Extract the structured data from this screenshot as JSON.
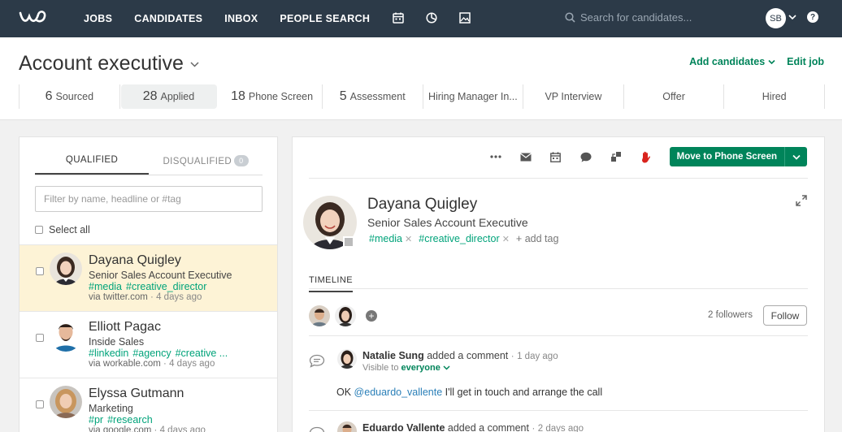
{
  "nav": {
    "items": [
      "JOBS",
      "CANDIDATES",
      "INBOX",
      "PEOPLE SEARCH"
    ],
    "icons": [
      "calendar-icon",
      "pie-chart-icon",
      "image-icon"
    ],
    "search_placeholder": "Search for candidates...",
    "user_initials": "SB",
    "help": "?"
  },
  "job": {
    "title": "Account executive",
    "add_candidates": "Add candidates",
    "edit_job": "Edit job",
    "stages": [
      {
        "count": "6",
        "label": "Sourced"
      },
      {
        "count": "28",
        "label": "Applied"
      },
      {
        "count": "18",
        "label": "Phone Screen"
      },
      {
        "count": "5",
        "label": "Assessment"
      },
      {
        "count": "",
        "label": "Hiring Manager In..."
      },
      {
        "count": "",
        "label": "VP Interview"
      },
      {
        "count": "",
        "label": "Offer"
      },
      {
        "count": "",
        "label": "Hired"
      }
    ]
  },
  "list": {
    "tab_qualified": "QUALIFIED",
    "tab_disqualified": "DISQUALIFIED",
    "disqualified_count": "0",
    "filter_placeholder": "Filter by name, headline or #tag",
    "select_all": "Select all",
    "candidates": [
      {
        "name": "Dayana Quigley",
        "headline": "Senior Sales Account Executive",
        "tags": [
          "#media",
          "#creative_director"
        ],
        "source": "via twitter.com",
        "date": "4 days ago"
      },
      {
        "name": "Elliott Pagac",
        "headline": "Inside Sales",
        "tags": [
          "#linkedin",
          "#agency",
          "#creative ..."
        ],
        "source": "via workable.com",
        "date": "4 days ago"
      },
      {
        "name": "Elyssa Gutmann",
        "headline": "Marketing",
        "tags": [
          "#pr",
          "#research"
        ],
        "source": "via google.com",
        "date": "4 days ago"
      }
    ]
  },
  "profile": {
    "move_button": "Move to Phone Screen",
    "name": "Dayana Quigley",
    "headline": "Senior Sales Account Executive",
    "tags": [
      "#media",
      "#creative_director"
    ],
    "add_tag": "+ add tag",
    "timeline_tab": "TIMELINE",
    "followers": "2 followers",
    "follow": "Follow",
    "activity": [
      {
        "author": "Natalie Sung",
        "action": "added a comment",
        "ago": "1 day ago",
        "visible_prefix": "Visible to",
        "visible_to": "everyone",
        "message_pre": "OK ",
        "mention": "@eduardo_vallente",
        "message_post": " I'll get in touch and arrange the call"
      },
      {
        "author": "Eduardo Vallente",
        "action": "added a comment",
        "ago": "2 days ago"
      }
    ]
  },
  "colors": {
    "nav_bg": "#2c3a48",
    "accent_green": "#00845a",
    "tag_green": "#00a37a",
    "selected_row": "#fdf3d6"
  }
}
